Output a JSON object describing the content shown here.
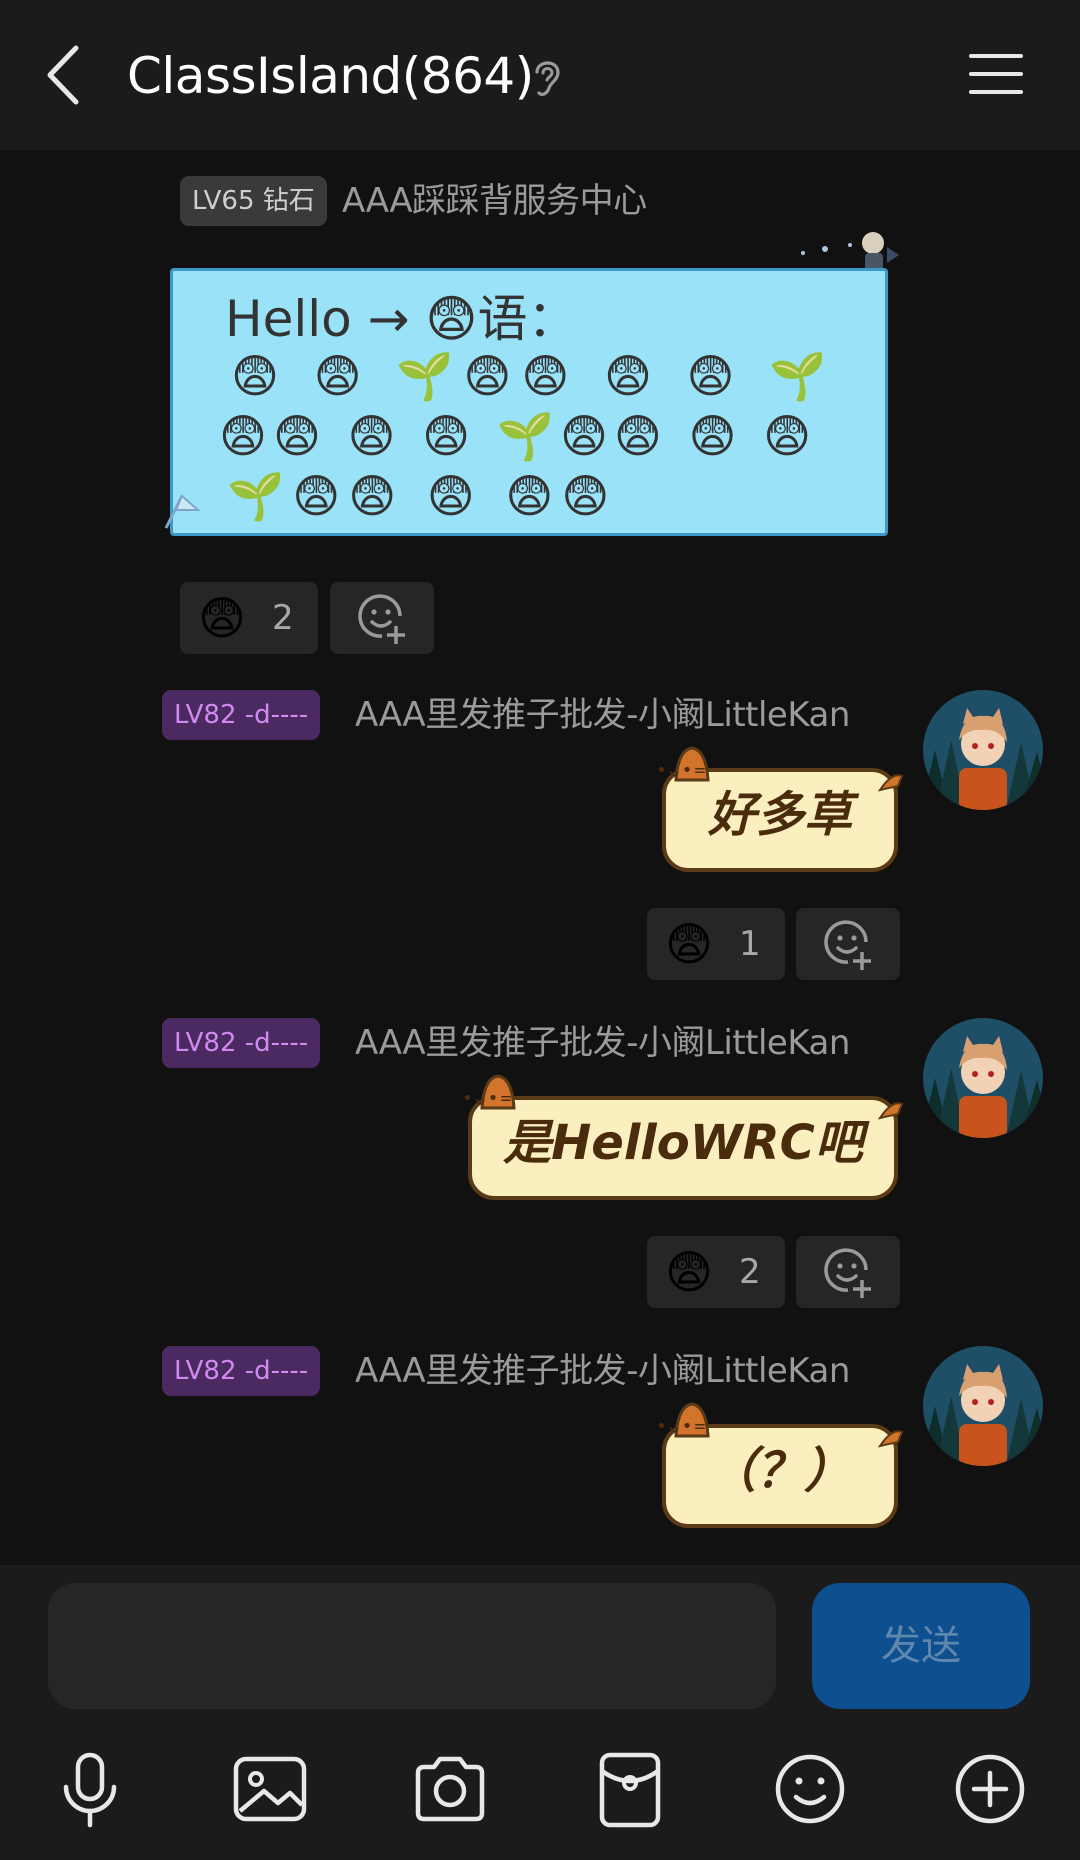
{
  "header": {
    "title": "ClassIsland(864)",
    "back_icon": "chevron-left-icon",
    "ear_icon": "ear-icon",
    "menu_icon": "hamburger-menu-icon"
  },
  "messages": [
    {
      "level": "LV65 钻石",
      "sender": "AAA踩踩背服务中心",
      "bubble_lines": [
        "Hello → 😨语：",
        "😨 😨 🌱😨😨 😨 😨 🌱",
        "😨😨 😨 😨 🌱😨😨 😨 😨",
        "🌱😨😨 😨 😨😨"
      ],
      "reaction": {
        "emoji": "😨",
        "count": "2"
      }
    },
    {
      "level": "LV82 -d----",
      "sender": "AAA里发推子批发-小阚LittleKan",
      "text": "好多草",
      "reaction": {
        "emoji": "😨",
        "count": "1"
      }
    },
    {
      "level": "LV82 -d----",
      "sender": "AAA里发推子批发-小阚LittleKan",
      "text": "是HelloWRC吧",
      "reaction": {
        "emoji": "😨",
        "count": "2"
      }
    },
    {
      "level": "LV82 -d----",
      "sender": "AAA里发推子批发-小阚LittleKan",
      "text": "（？）"
    }
  ],
  "cat_face": "•ᴗ•=",
  "input": {
    "value": "",
    "placeholder": ""
  },
  "send_label": "发送",
  "toolbar_icons": [
    "microphone-icon",
    "image-icon",
    "camera-icon",
    "red-packet-icon",
    "emoji-icon",
    "plus-icon"
  ],
  "colors": {
    "background": "#111111",
    "bar": "#1b1b1b",
    "blue_bubble": "#99e2f8",
    "cat_bubble": "#fbefc0",
    "send_button": "#0d4f8f"
  }
}
